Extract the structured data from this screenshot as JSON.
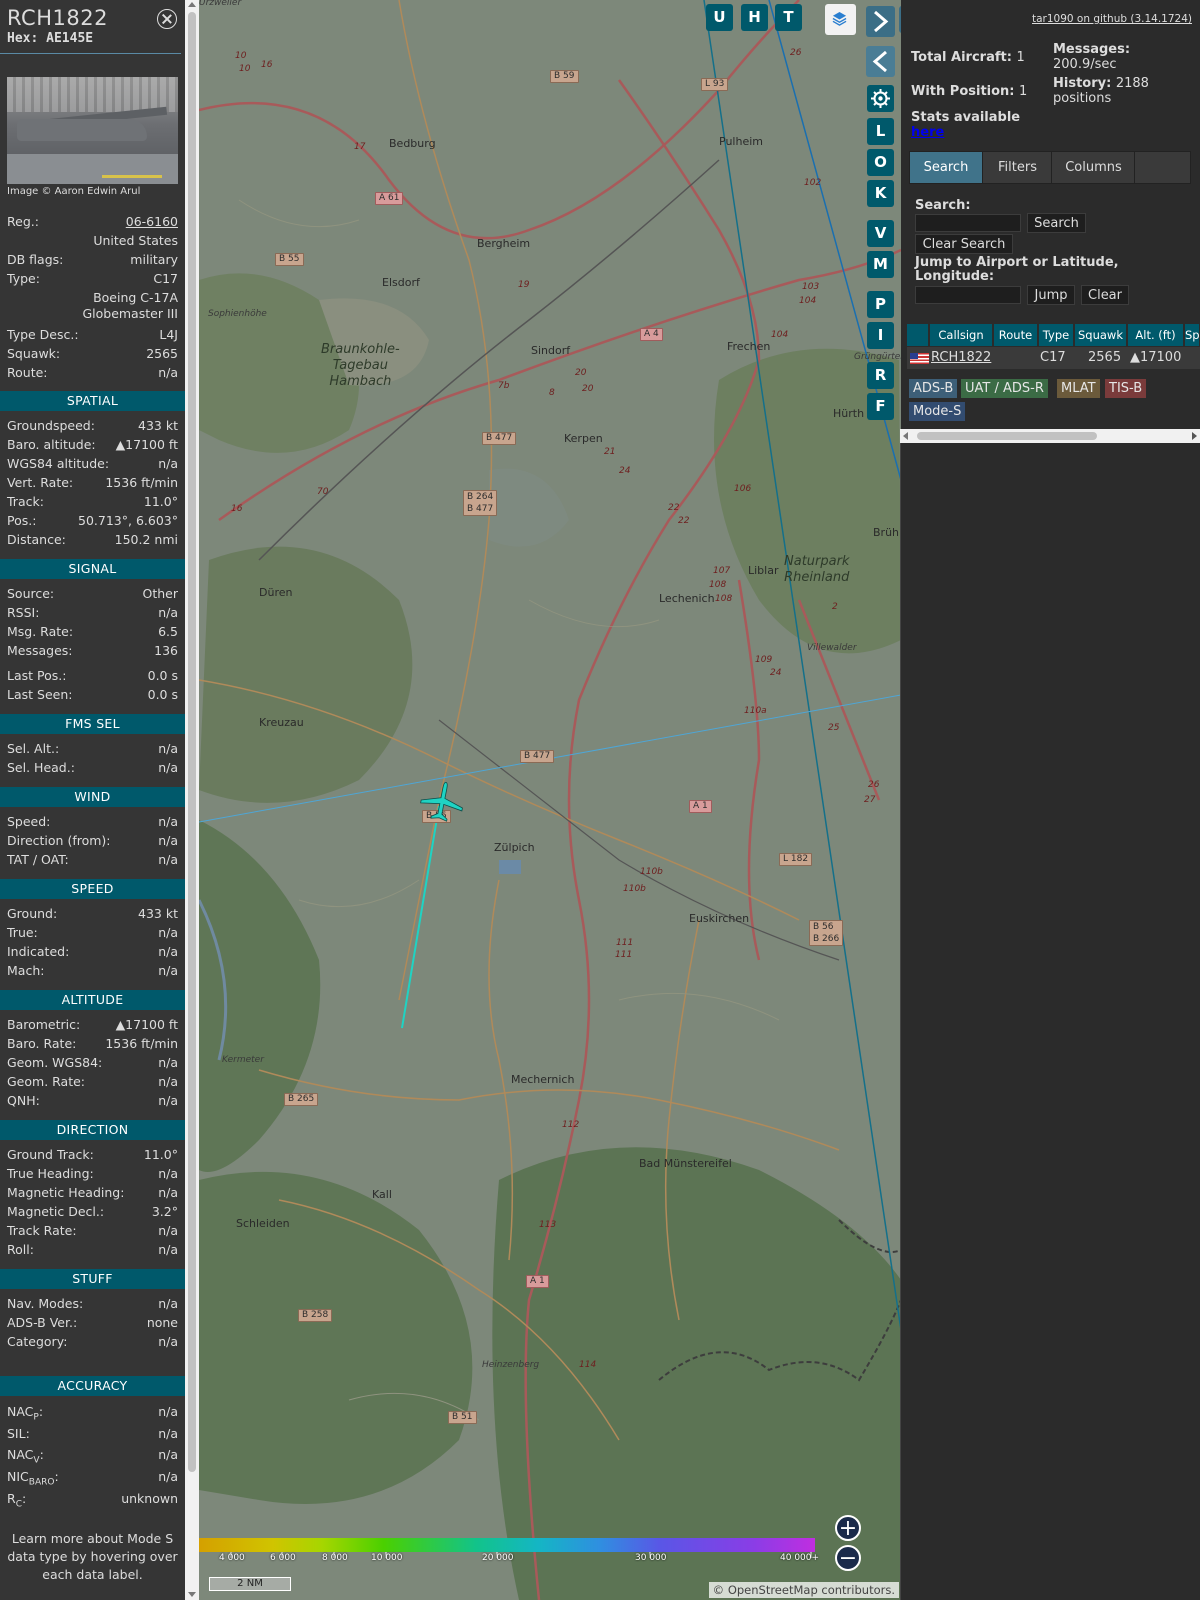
{
  "aircraft": {
    "callsign": "RCH1822",
    "hex_label": "Hex:",
    "hex": "AE145E",
    "photo_credit": "Image © Aaron Edwin Arul"
  },
  "info": {
    "reg_k": "Reg.:",
    "reg_v": "06-6160",
    "country": "United States",
    "dbflags_k": "DB flags:",
    "dbflags_v": "military",
    "type_k": "Type:",
    "type_v": "C17",
    "model_l1": "Boeing C-17A",
    "model_l2": "Globemaster III",
    "typedesc_k": "Type Desc.:",
    "typedesc_v": "L4J",
    "squawk_k": "Squawk:",
    "squawk_v": "2565",
    "route_k": "Route:",
    "route_v": "n/a"
  },
  "sections": {
    "spatial": "SPATIAL",
    "signal": "SIGNAL",
    "fms": "FMS SEL",
    "wind": "WIND",
    "speed": "SPEED",
    "altitude": "ALTITUDE",
    "direction": "DIRECTION",
    "stuff": "STUFF",
    "accuracy": "ACCURACY"
  },
  "spatial": {
    "gs_k": "Groundspeed:",
    "gs_v": "433 kt",
    "baro_k": "Baro. altitude:",
    "baro_v": "▲17100 ft",
    "wgs_k": "WGS84 altitude:",
    "wgs_v": "n/a",
    "vr_k": "Vert. Rate:",
    "vr_v": "1536 ft/min",
    "track_k": "Track:",
    "track_v": "11.0°",
    "pos_k": "Pos.:",
    "pos_v": "50.713°, 6.603°",
    "dist_k": "Distance:",
    "dist_v": "150.2 nmi"
  },
  "signal": {
    "src_k": "Source:",
    "src_v": "Other",
    "rssi_k": "RSSI:",
    "rssi_v": "n/a",
    "msgrate_k": "Msg. Rate:",
    "msgrate_v": "6.5",
    "msgs_k": "Messages:",
    "msgs_v": "136",
    "lastpos_k": "Last Pos.:",
    "lastpos_v": "0.0 s",
    "lastseen_k": "Last Seen:",
    "lastseen_v": "0.0 s"
  },
  "fms": {
    "selalt_k": "Sel. Alt.:",
    "selalt_v": "n/a",
    "selhead_k": "Sel. Head.:",
    "selhead_v": "n/a"
  },
  "wind": {
    "speed_k": "Speed:",
    "speed_v": "n/a",
    "dir_k": "Direction (from):",
    "dir_v": "n/a",
    "tat_k": "TAT / OAT:",
    "tat_v": "n/a"
  },
  "speed": {
    "ground_k": "Ground:",
    "ground_v": "433 kt",
    "true_k": "True:",
    "true_v": "n/a",
    "ind_k": "Indicated:",
    "ind_v": "n/a",
    "mach_k": "Mach:",
    "mach_v": "n/a"
  },
  "altitude": {
    "baro_k": "Barometric:",
    "baro_v": "▲17100 ft",
    "rate_k": "Baro. Rate:",
    "rate_v": "1536 ft/min",
    "geom_k": "Geom. WGS84:",
    "geom_v": "n/a",
    "georate_k": "Geom. Rate:",
    "georate_v": "n/a",
    "qnh_k": "QNH:",
    "qnh_v": "n/a"
  },
  "direction": {
    "gt_k": "Ground Track:",
    "gt_v": "11.0°",
    "th_k": "True Heading:",
    "th_v": "n/a",
    "mh_k": "Magnetic Heading:",
    "mh_v": "n/a",
    "md_k": "Magnetic Decl.:",
    "md_v": "3.2°",
    "tr_k": "Track Rate:",
    "tr_v": "n/a",
    "roll_k": "Roll:",
    "roll_v": "n/a"
  },
  "stuff": {
    "nav_k": "Nav. Modes:",
    "nav_v": "n/a",
    "adsb_k": "ADS-B Ver.:",
    "adsb_v": "none",
    "cat_k": "Category:",
    "cat_v": "n/a"
  },
  "accuracy": {
    "nacp_k": "NAC",
    "nacp_sub": "P",
    "nacp_v": "n/a",
    "sil_k": "SIL:",
    "sil_v": "n/a",
    "nacv_k": "NAC",
    "nacv_sub": "V",
    "nacv_v": "n/a",
    "nicb_k": "NIC",
    "nicb_sub": "BARO",
    "nicb_v": "n/a",
    "rc_k": "R",
    "rc_sub": "C",
    "rc_v": "unknown"
  },
  "note": "Learn more about Mode S data type by hovering over each data label.",
  "map": {
    "buttons": [
      "U",
      "H",
      "T"
    ],
    "side_buttons": [
      "L",
      "O",
      "K",
      "V",
      "M",
      "P",
      "I",
      "R",
      "F"
    ],
    "places": [
      "Bedburg",
      "Pulheim",
      "Bergheim",
      "Elsdorf",
      "Sindorf",
      "Frechen",
      "Kerpen",
      "Hürth",
      "Düren",
      "Lechenich",
      "Liblar",
      "Kreuzau",
      "Zülpich",
      "Euskirchen",
      "Mechernich",
      "Bad Münstereifel",
      "Kall",
      "Schleiden",
      "Brüh"
    ],
    "small_places": [
      "Sophienhöhe",
      "Kermeter",
      "Heinzenberg",
      "Villewalder",
      "Grüngürtel",
      "Urzweiler"
    ],
    "big_places": [
      "Braunkohle-",
      "Tagebau",
      "Hambach",
      "Naturpark",
      "Rheinland"
    ],
    "shields": [
      "B 59",
      "L 93",
      "A 61",
      "B 55",
      "A 4",
      "B 477",
      "B 264",
      "B 477",
      "B 477",
      "B 56",
      "A 1",
      "L 182",
      "B 56",
      "B 266",
      "B 265",
      "B 258",
      "A 1",
      "B 51"
    ],
    "road_numbers": [
      "10",
      "16",
      "10",
      "17",
      "26",
      "19",
      "102",
      "103",
      "104",
      "104",
      "7b",
      "8",
      "20",
      "20",
      "21",
      "24",
      "22",
      "22",
      "106",
      "107",
      "108",
      "108",
      "2",
      "109",
      "24",
      "110a",
      "25",
      "26",
      "27",
      "110b",
      "110b",
      "111",
      "111",
      "112",
      "113",
      "114",
      "16",
      "70"
    ],
    "colorbar_ticks": [
      "4 000",
      "6 000",
      "8 000",
      "10 000",
      "20 000",
      "30 000",
      "40 000+"
    ],
    "scale": "2 NM",
    "attribution_prefix": "© ",
    "attribution_link": "OpenStreetMap",
    "attribution_suffix": " contributors.",
    "zoom_in": "+",
    "zoom_out": "−"
  },
  "sidebar": {
    "github": "tar1090 on github (3.14.1724)",
    "total_label": "Total Aircraft:",
    "total_value": "1",
    "messages_label": "Messages:",
    "messages_value": "200.9/sec",
    "withpos_label": "With Position:",
    "withpos_value": "1",
    "history_label": "History:",
    "history_value": "2188",
    "history_unit": "positions",
    "stats_label": "Stats available",
    "stats_link": "here",
    "tabs": [
      "Search",
      "Filters",
      "Columns"
    ],
    "search_label": "Search:",
    "search_btn": "Search",
    "clear_search_btn": "Clear Search",
    "jump_label": "Jump to Airport or Latitude, Longitude:",
    "jump_btn": "Jump",
    "clear_btn": "Clear",
    "columns": [
      "Callsign",
      "Route",
      "Type",
      "Squawk",
      "Alt. (ft)",
      "Sp"
    ],
    "row": {
      "callsign": "RCH1822",
      "route": "",
      "type": "C17",
      "squawk": "2565",
      "alt": "▲17100"
    },
    "badges": [
      {
        "label": "ADS-B",
        "bg": "#3d5f78",
        "fg": "#e6e6e6"
      },
      {
        "label": "UAT / ADS-R",
        "bg": "#3b6b45",
        "fg": "#e6e6e6"
      },
      {
        "label": "MLAT",
        "bg": "#6b5a3b",
        "fg": "#e6e6e6"
      },
      {
        "label": "TIS-B",
        "bg": "#7a3b3b",
        "fg": "#e6e6e6"
      },
      {
        "label": "Mode-S",
        "bg": "#324c70",
        "fg": "#e6e6e6"
      }
    ]
  }
}
